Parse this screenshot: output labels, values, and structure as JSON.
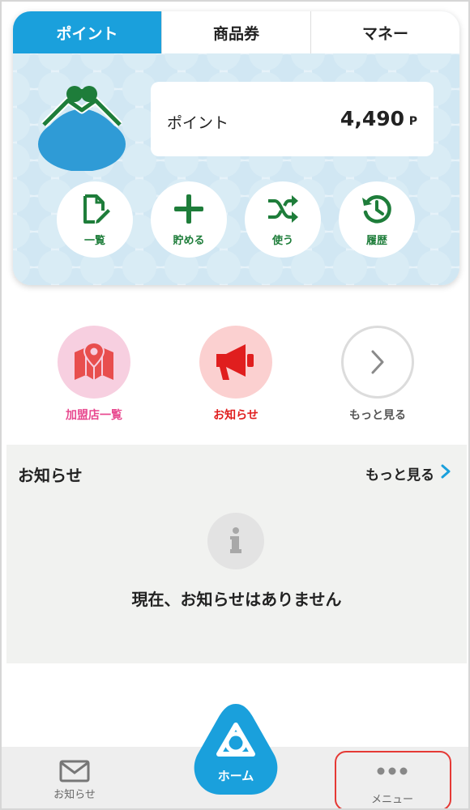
{
  "tabs": [
    "ポイント",
    "商品券",
    "マネー"
  ],
  "point_card": {
    "label": "ポイント",
    "value": "4,490",
    "unit": "P"
  },
  "actions": [
    {
      "label": "一覧",
      "icon": "document-edit-icon"
    },
    {
      "label": "貯める",
      "icon": "plus-icon"
    },
    {
      "label": "使う",
      "icon": "shuffle-icon"
    },
    {
      "label": "履歴",
      "icon": "history-icon"
    }
  ],
  "shortcuts": [
    {
      "label": "加盟店一覧",
      "icon": "store-map-icon",
      "color": "#e8498f"
    },
    {
      "label": "お知らせ",
      "icon": "megaphone-icon",
      "color": "#e01e1e"
    },
    {
      "label": "もっと見る",
      "icon": "chevron-right-icon",
      "color": "#555555"
    }
  ],
  "notice": {
    "title": "お知らせ",
    "more": "もっと見る",
    "empty_message": "現在、お知らせはありません"
  },
  "bottom_nav": {
    "notices": "お知らせ",
    "home": "ホーム",
    "menu": "メニュー"
  },
  "colors": {
    "accent": "#1aa0dc",
    "action_green": "#1e7d3a",
    "highlight_red": "#e53935"
  }
}
